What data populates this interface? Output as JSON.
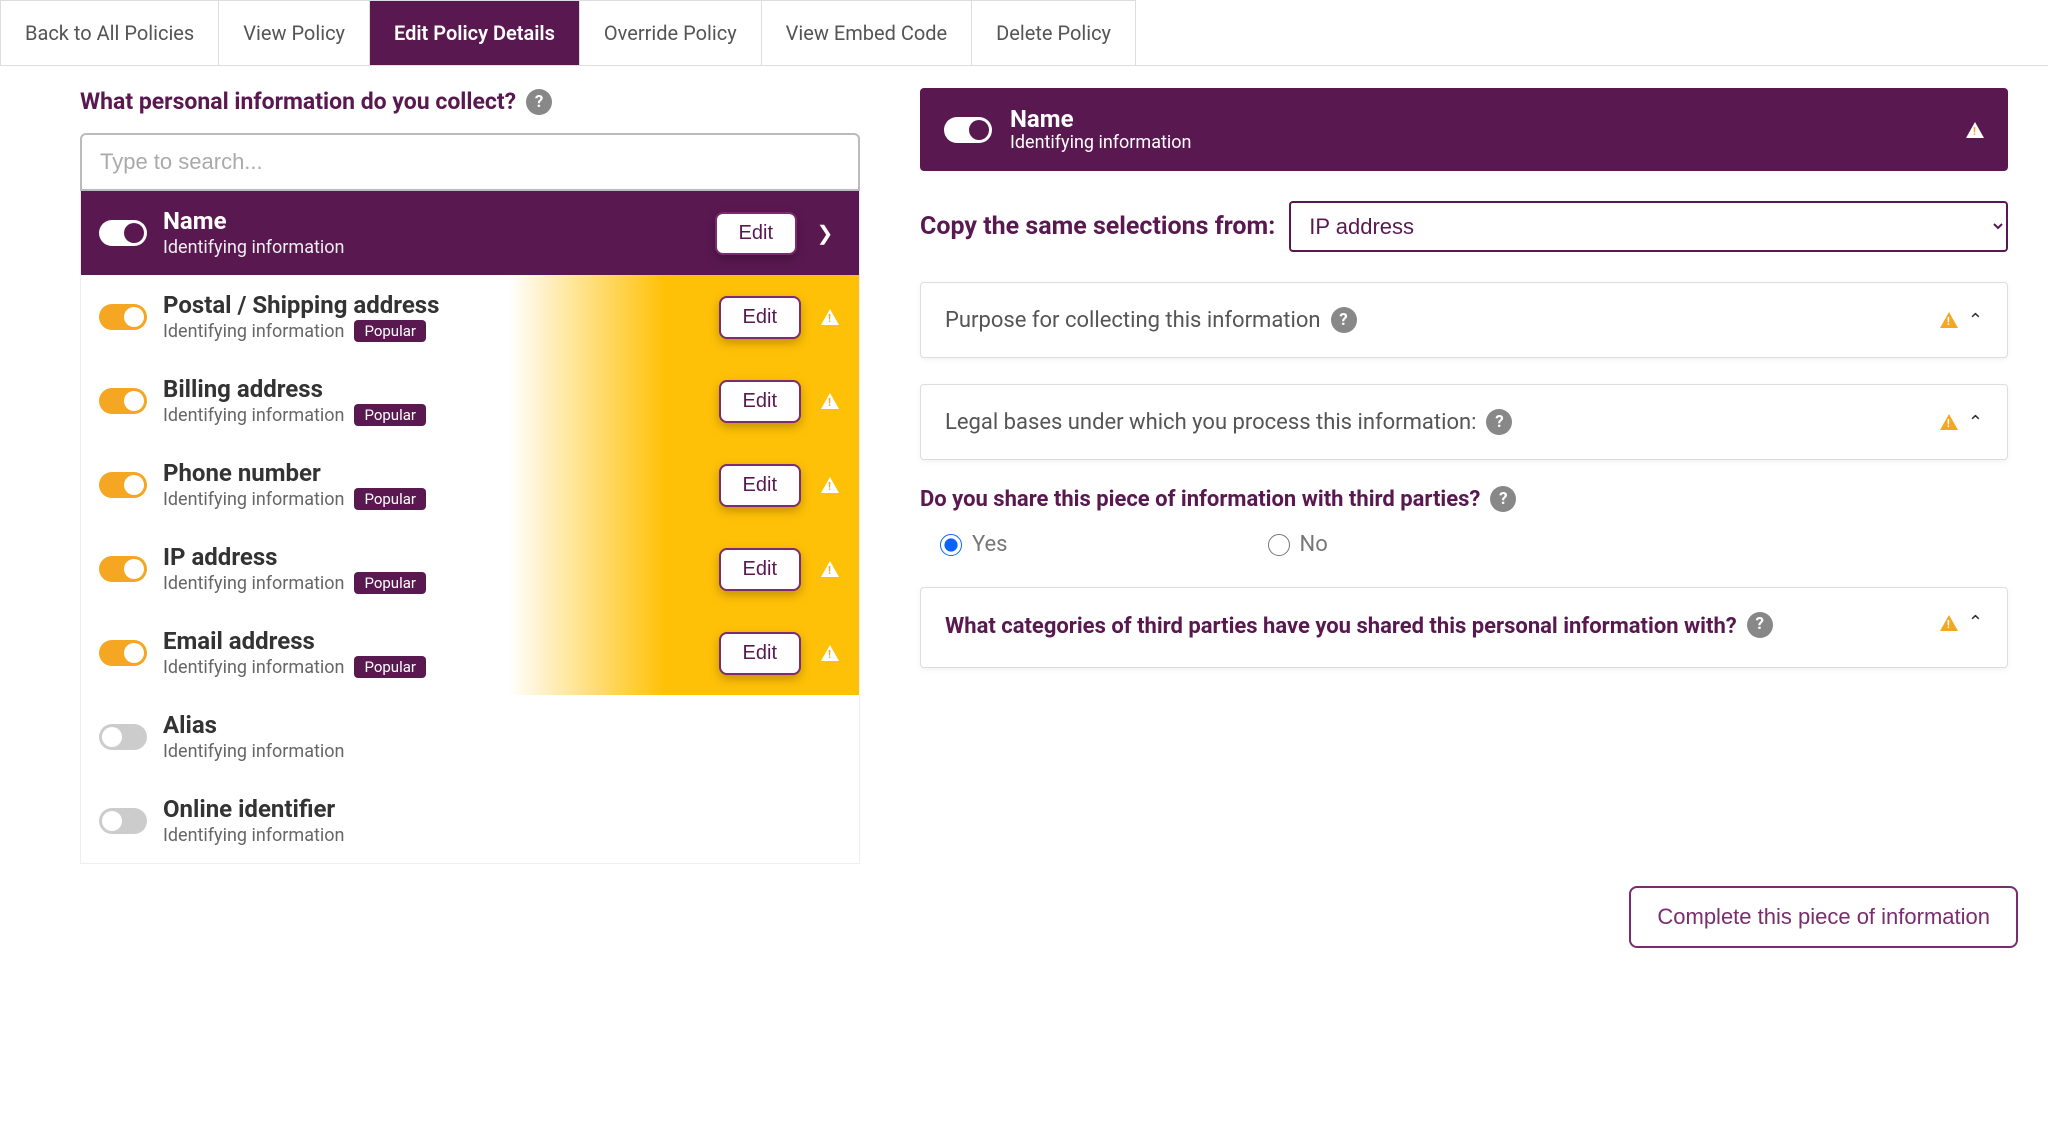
{
  "tabs": {
    "back": "Back to All Policies",
    "view": "View Policy",
    "edit": "Edit Policy Details",
    "override": "Override Policy",
    "embed": "View Embed Code",
    "delete": "Delete Policy"
  },
  "left": {
    "title": "What personal information do you collect?",
    "search_placeholder": "Type to search...",
    "items": [
      {
        "title": "Name",
        "sub": "Identifying information",
        "popular": false,
        "on": true,
        "selected": true,
        "warning": false,
        "edit": "Edit",
        "off": false
      },
      {
        "title": "Postal / Shipping address",
        "sub": "Identifying information",
        "popular": true,
        "on": true,
        "selected": false,
        "warning": true,
        "edit": "Edit",
        "off": false
      },
      {
        "title": "Billing address",
        "sub": "Identifying information",
        "popular": true,
        "on": true,
        "selected": false,
        "warning": true,
        "edit": "Edit",
        "off": false
      },
      {
        "title": "Phone number",
        "sub": "Identifying information",
        "popular": true,
        "on": true,
        "selected": false,
        "warning": true,
        "edit": "Edit",
        "off": false
      },
      {
        "title": "IP address",
        "sub": "Identifying information",
        "popular": true,
        "on": true,
        "selected": false,
        "warning": true,
        "edit": "Edit",
        "off": false
      },
      {
        "title": "Email address",
        "sub": "Identifying information",
        "popular": true,
        "on": true,
        "selected": false,
        "warning": true,
        "edit": "Edit",
        "off": false
      },
      {
        "title": "Alias",
        "sub": "Identifying information",
        "popular": false,
        "on": false,
        "selected": false,
        "warning": false,
        "edit": "",
        "off": true
      },
      {
        "title": "Online identifier",
        "sub": "Identifying information",
        "popular": false,
        "on": false,
        "selected": false,
        "warning": false,
        "edit": "",
        "off": true
      }
    ],
    "popular_badge": "Popular"
  },
  "right": {
    "header_title": "Name",
    "header_sub": "Identifying information",
    "copy_label": "Copy the same selections from:",
    "copy_value": "IP address",
    "panel1": "Purpose for collecting this information",
    "panel2": "Legal bases under which you process this information:",
    "q_share": "Do you share this piece of information with third parties?",
    "yes": "Yes",
    "no": "No",
    "panel3": "What categories of third parties have you shared this personal information with?",
    "complete": "Complete this piece of information"
  }
}
